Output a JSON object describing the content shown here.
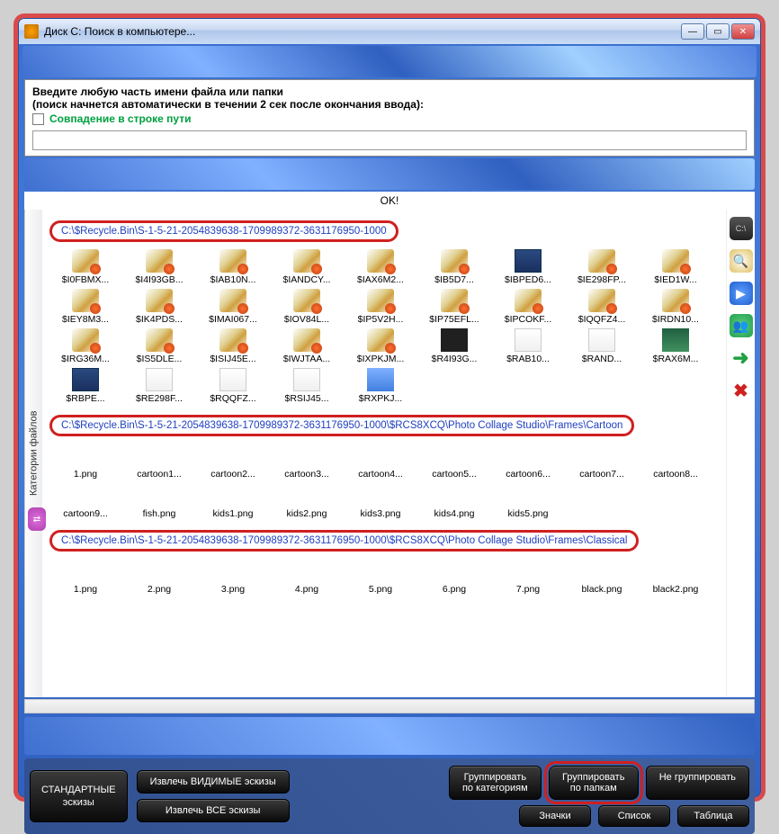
{
  "window": {
    "title": "Диск C: Поиск в компьютере..."
  },
  "search": {
    "line1": "Введите любую часть имени файла или папки",
    "line2": "(поиск начнется автоматически в течении 2 сек после окончания ввода):",
    "match_path": "Совпадение в строке пути"
  },
  "status": "OK!",
  "sidebar_label": "Категории файлов",
  "groups": [
    {
      "path": "C:\\$Recycle.Bin\\S-1-5-21-2054839638-1709989372-3631176950-1000",
      "items": [
        {
          "n": "$I0FBMX...",
          "t": "generic"
        },
        {
          "n": "$I4I93GB...",
          "t": "generic"
        },
        {
          "n": "$IAB10N...",
          "t": "generic"
        },
        {
          "n": "$IANDCY...",
          "t": "generic"
        },
        {
          "n": "$IAX6M2...",
          "t": "generic"
        },
        {
          "n": "$IB5D7...",
          "t": "generic"
        },
        {
          "n": "$IBPED6...",
          "t": "ps"
        },
        {
          "n": "$IE298FP...",
          "t": "generic"
        },
        {
          "n": "$IED1W...",
          "t": "generic"
        },
        {
          "n": "$IEY8M3...",
          "t": "generic"
        },
        {
          "n": "$IK4PDS...",
          "t": "generic"
        },
        {
          "n": "$IMAI067...",
          "t": "generic"
        },
        {
          "n": "$IOV84L...",
          "t": "generic"
        },
        {
          "n": "$IP5V2H...",
          "t": "generic"
        },
        {
          "n": "$IP75EFL...",
          "t": "generic"
        },
        {
          "n": "$IPCOKF...",
          "t": "generic"
        },
        {
          "n": "$IQQFZ4...",
          "t": "generic"
        },
        {
          "n": "$IRDN10...",
          "t": "generic"
        },
        {
          "n": "$IRG36M...",
          "t": "generic"
        },
        {
          "n": "$IS5DLE...",
          "t": "generic"
        },
        {
          "n": "$ISIJ45E...",
          "t": "generic"
        },
        {
          "n": "$IWJTAA...",
          "t": "generic"
        },
        {
          "n": "$IXPKJM...",
          "t": "generic"
        },
        {
          "n": "$R4I93G...",
          "t": "dark"
        },
        {
          "n": "$RAB10...",
          "t": "file"
        },
        {
          "n": "$RAND...",
          "t": "file"
        },
        {
          "n": "$RAX6M...",
          "t": "green"
        },
        {
          "n": "$RBPE...",
          "t": "ps"
        },
        {
          "n": "$RE298F...",
          "t": "file"
        },
        {
          "n": "$RQQFZ...",
          "t": "file"
        },
        {
          "n": "$RSIJ45...",
          "t": "file"
        },
        {
          "n": "$RXPKJ...",
          "t": "blue"
        }
      ]
    },
    {
      "path": "C:\\$Recycle.Bin\\S-1-5-21-2054839638-1709989372-3631176950-1000\\$RCS8XCQ\\Photo Collage Studio\\Frames\\Cartoon",
      "items": [
        {
          "n": "1.png",
          "t": "empty"
        },
        {
          "n": "cartoon1...",
          "t": "empty"
        },
        {
          "n": "cartoon2...",
          "t": "empty"
        },
        {
          "n": "cartoon3...",
          "t": "empty"
        },
        {
          "n": "cartoon4...",
          "t": "empty"
        },
        {
          "n": "cartoon5...",
          "t": "empty"
        },
        {
          "n": "cartoon6...",
          "t": "empty"
        },
        {
          "n": "cartoon7...",
          "t": "empty"
        },
        {
          "n": "cartoon8...",
          "t": "empty"
        },
        {
          "n": "cartoon9...",
          "t": "empty"
        },
        {
          "n": "fish.png",
          "t": "empty"
        },
        {
          "n": "kids1.png",
          "t": "empty"
        },
        {
          "n": "kids2.png",
          "t": "empty"
        },
        {
          "n": "kids3.png",
          "t": "empty"
        },
        {
          "n": "kids4.png",
          "t": "empty"
        },
        {
          "n": "kids5.png",
          "t": "empty"
        }
      ]
    },
    {
      "path": "C:\\$Recycle.Bin\\S-1-5-21-2054839638-1709989372-3631176950-1000\\$RCS8XCQ\\Photo Collage Studio\\Frames\\Classical",
      "items": [
        {
          "n": "1.png",
          "t": "empty"
        },
        {
          "n": "2.png",
          "t": "empty"
        },
        {
          "n": "3.png",
          "t": "empty"
        },
        {
          "n": "4.png",
          "t": "empty"
        },
        {
          "n": "5.png",
          "t": "empty"
        },
        {
          "n": "6.png",
          "t": "empty"
        },
        {
          "n": "7.png",
          "t": "empty"
        },
        {
          "n": "black.png",
          "t": "empty"
        },
        {
          "n": "black2.png",
          "t": "empty"
        }
      ]
    }
  ],
  "buttons": {
    "std": "СТАНДАРТНЫЕ\nэскизы",
    "extract_visible": "Извлечь ВИДИМЫЕ эскизы",
    "extract_all": "Извлечь ВСЕ эскизы",
    "group_cat": "Группировать\nпо категориям",
    "group_folder": "Группировать\nпо папкам",
    "no_group": "Не группировать",
    "icons": "Значки",
    "list": "Список",
    "table": "Таблица"
  }
}
